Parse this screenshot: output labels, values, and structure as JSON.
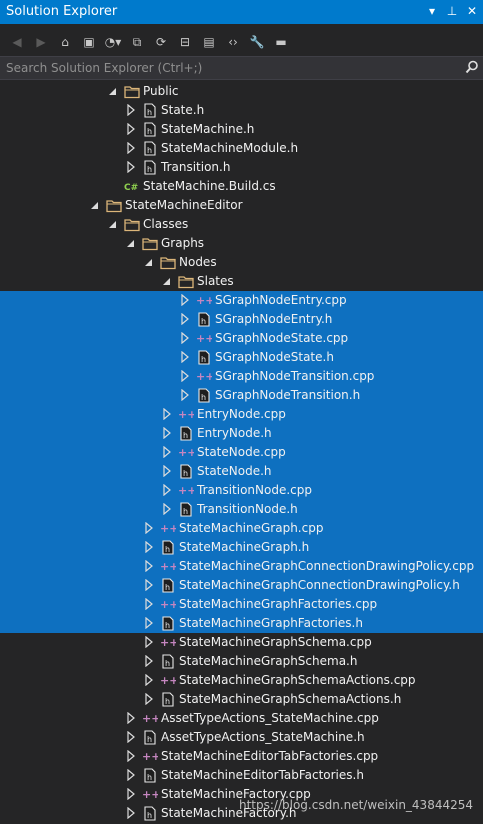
{
  "window": {
    "title": "Solution Explorer"
  },
  "search": {
    "placeholder": "Search Solution Explorer (Ctrl+;)"
  },
  "tree": [
    {
      "label": "Public",
      "kind": "folder",
      "depth": 2,
      "expanded": true,
      "selected": false
    },
    {
      "label": "State.h",
      "kind": "h",
      "depth": 3,
      "expanded": false,
      "selected": false
    },
    {
      "label": "StateMachine.h",
      "kind": "h",
      "depth": 3,
      "expanded": false,
      "selected": false
    },
    {
      "label": "StateMachineModule.h",
      "kind": "h",
      "depth": 3,
      "expanded": false,
      "selected": false
    },
    {
      "label": "Transition.h",
      "kind": "h",
      "depth": 3,
      "expanded": false,
      "selected": false
    },
    {
      "label": "StateMachine.Build.cs",
      "kind": "cs",
      "depth": 2,
      "expanded": null,
      "selected": false
    },
    {
      "label": "StateMachineEditor",
      "kind": "folder",
      "depth": 1,
      "expanded": true,
      "selected": false
    },
    {
      "label": "Classes",
      "kind": "folder",
      "depth": 2,
      "expanded": true,
      "selected": false
    },
    {
      "label": "Graphs",
      "kind": "folder",
      "depth": 3,
      "expanded": true,
      "selected": false
    },
    {
      "label": "Nodes",
      "kind": "folder",
      "depth": 4,
      "expanded": true,
      "selected": false
    },
    {
      "label": "Slates",
      "kind": "folder",
      "depth": 5,
      "expanded": true,
      "selected": false
    },
    {
      "label": "SGraphNodeEntry.cpp",
      "kind": "cpp",
      "depth": 6,
      "expanded": false,
      "selected": true
    },
    {
      "label": "SGraphNodeEntry.h",
      "kind": "h",
      "depth": 6,
      "expanded": false,
      "selected": true
    },
    {
      "label": "SGraphNodeState.cpp",
      "kind": "cpp",
      "depth": 6,
      "expanded": false,
      "selected": true
    },
    {
      "label": "SGraphNodeState.h",
      "kind": "h",
      "depth": 6,
      "expanded": false,
      "selected": true
    },
    {
      "label": "SGraphNodeTransition.cpp",
      "kind": "cpp",
      "depth": 6,
      "expanded": false,
      "selected": true
    },
    {
      "label": "SGraphNodeTransition.h",
      "kind": "h",
      "depth": 6,
      "expanded": false,
      "selected": true
    },
    {
      "label": "EntryNode.cpp",
      "kind": "cpp",
      "depth": 5,
      "expanded": false,
      "selected": true
    },
    {
      "label": "EntryNode.h",
      "kind": "h",
      "depth": 5,
      "expanded": false,
      "selected": true
    },
    {
      "label": "StateNode.cpp",
      "kind": "cpp",
      "depth": 5,
      "expanded": false,
      "selected": true
    },
    {
      "label": "StateNode.h",
      "kind": "h",
      "depth": 5,
      "expanded": false,
      "selected": true
    },
    {
      "label": "TransitionNode.cpp",
      "kind": "cpp",
      "depth": 5,
      "expanded": false,
      "selected": true
    },
    {
      "label": "TransitionNode.h",
      "kind": "h",
      "depth": 5,
      "expanded": false,
      "selected": true
    },
    {
      "label": "StateMachineGraph.cpp",
      "kind": "cpp",
      "depth": 4,
      "expanded": false,
      "selected": true
    },
    {
      "label": "StateMachineGraph.h",
      "kind": "h",
      "depth": 4,
      "expanded": false,
      "selected": true
    },
    {
      "label": "StateMachineGraphConnectionDrawingPolicy.cpp",
      "kind": "cpp",
      "depth": 4,
      "expanded": false,
      "selected": true
    },
    {
      "label": "StateMachineGraphConnectionDrawingPolicy.h",
      "kind": "h",
      "depth": 4,
      "expanded": false,
      "selected": true
    },
    {
      "label": "StateMachineGraphFactories.cpp",
      "kind": "cpp",
      "depth": 4,
      "expanded": false,
      "selected": true
    },
    {
      "label": "StateMachineGraphFactories.h",
      "kind": "h",
      "depth": 4,
      "expanded": false,
      "selected": true
    },
    {
      "label": "StateMachineGraphSchema.cpp",
      "kind": "cpp",
      "depth": 4,
      "expanded": false,
      "selected": false
    },
    {
      "label": "StateMachineGraphSchema.h",
      "kind": "h",
      "depth": 4,
      "expanded": false,
      "selected": false
    },
    {
      "label": "StateMachineGraphSchemaActions.cpp",
      "kind": "cpp",
      "depth": 4,
      "expanded": false,
      "selected": false
    },
    {
      "label": "StateMachineGraphSchemaActions.h",
      "kind": "h",
      "depth": 4,
      "expanded": false,
      "selected": false
    },
    {
      "label": "AssetTypeActions_StateMachine.cpp",
      "kind": "cpp",
      "depth": 3,
      "expanded": false,
      "selected": false
    },
    {
      "label": "AssetTypeActions_StateMachine.h",
      "kind": "h",
      "depth": 3,
      "expanded": false,
      "selected": false
    },
    {
      "label": "StateMachineEditorTabFactories.cpp",
      "kind": "cpp",
      "depth": 3,
      "expanded": false,
      "selected": false
    },
    {
      "label": "StateMachineEditorTabFactories.h",
      "kind": "h",
      "depth": 3,
      "expanded": false,
      "selected": false
    },
    {
      "label": "StateMachineFactory.cpp",
      "kind": "cpp",
      "depth": 3,
      "expanded": false,
      "selected": false
    },
    {
      "label": "StateMachineFactory.h",
      "kind": "h",
      "depth": 3,
      "expanded": false,
      "selected": false
    }
  ],
  "watermark": "https://blog.csdn.net/weixin_43844254",
  "colors": {
    "title_bar": "#007acc",
    "selection": "#0e70c0",
    "background": "#252526",
    "cpp_icon": "#c586c0",
    "cs_icon": "#8fd14f",
    "folder_icon": "#dcb67a"
  }
}
